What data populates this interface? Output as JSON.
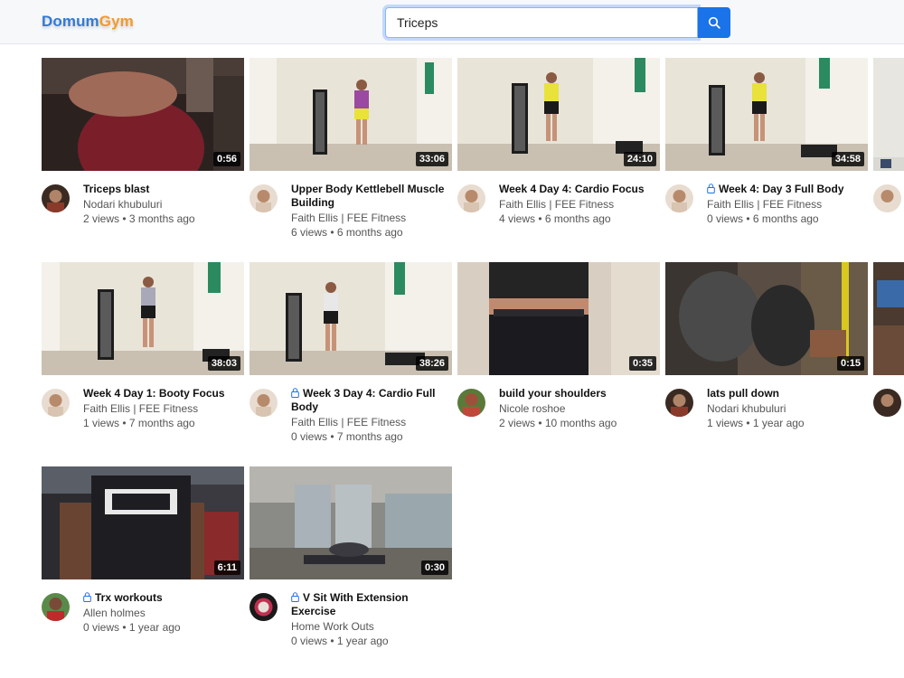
{
  "header": {
    "logo_part1": "Domum",
    "logo_part2": "Gym",
    "search_value": "Triceps",
    "search_icon": "search-icon",
    "accent_color": "#1a73e8"
  },
  "videos": [
    {
      "title": "Triceps blast",
      "channel": "Nodari khubuluri",
      "stats": "2 views • 3 months ago",
      "duration": "0:56",
      "locked": false
    },
    {
      "title": "Upper Body Kettlebell Muscle Building",
      "channel": "Faith Ellis | FEE Fitness",
      "stats": "6 views • 6 months ago",
      "duration": "33:06",
      "locked": false
    },
    {
      "title": "Week 4 Day 4: Cardio Focus",
      "channel": "Faith Ellis | FEE Fitness",
      "stats": "4 views • 6 months ago",
      "duration": "24:10",
      "locked": false
    },
    {
      "title": "Week 4: Day 3 Full Body",
      "channel": "Faith Ellis | FEE Fitness",
      "stats": "0 views • 6 months ago",
      "duration": "34:58",
      "locked": true
    },
    {
      "title": "Week 4 Day 1: Booty Focus",
      "channel": "Faith Ellis | FEE Fitness",
      "stats": "1 views • 7 months ago",
      "duration": "38:03",
      "locked": false
    },
    {
      "title": "Week 3 Day 4: Cardio Full Body",
      "channel": "Faith Ellis | FEE Fitness",
      "stats": "0 views • 7 months ago",
      "duration": "38:26",
      "locked": true
    },
    {
      "title": "build your shoulders",
      "channel": "Nicole roshoe",
      "stats": "2 views • 10 months ago",
      "duration": "0:35",
      "locked": false
    },
    {
      "title": "lats pull down",
      "channel": "Nodari khubuluri",
      "stats": "1 views • 1 year ago",
      "duration": "0:15",
      "locked": false
    },
    {
      "title": "Trx workouts",
      "channel": "Allen holmes",
      "stats": "0 views • 1 year ago",
      "duration": "6:11",
      "locked": true
    },
    {
      "title": "V Sit With Extension Exercise",
      "channel": "Home Work Outs",
      "stats": "0 views • 1 year ago",
      "duration": "0:30",
      "locked": true
    }
  ]
}
